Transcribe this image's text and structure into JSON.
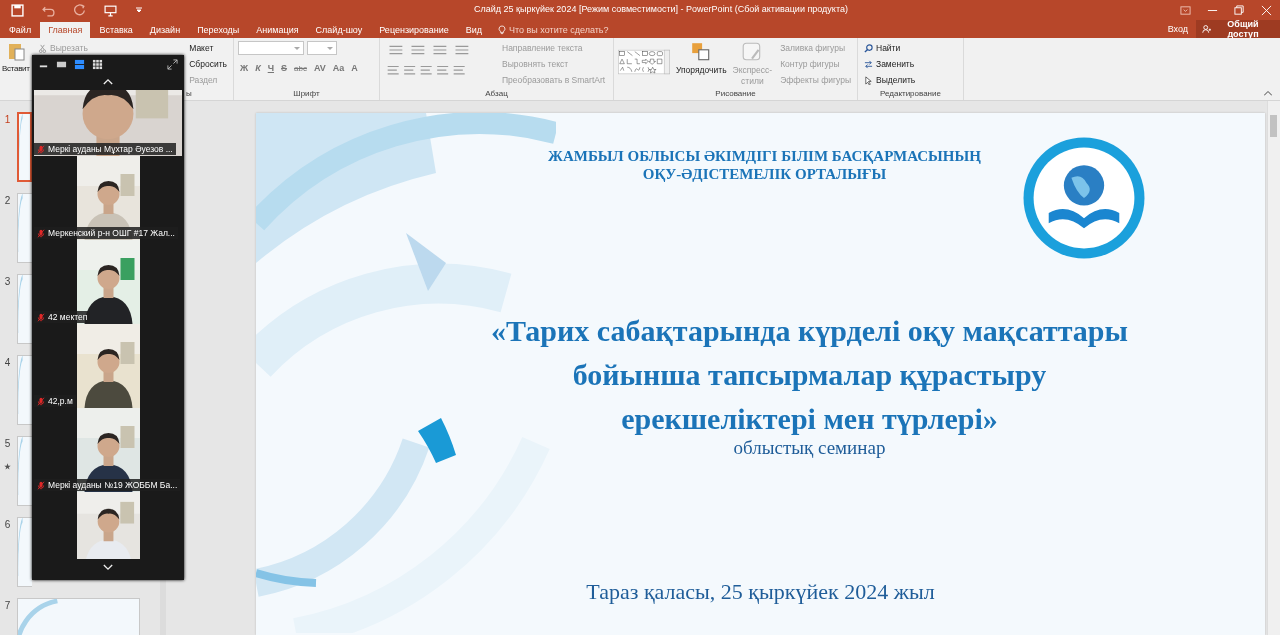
{
  "title_bar": {
    "title": "Слайд 25 қыркүйек  2024 [Режим совместимости] - PowerPoint (Сбой активации продукта)"
  },
  "tabs": [
    {
      "label": "Файл",
      "selected": false
    },
    {
      "label": "Главная",
      "selected": true
    },
    {
      "label": "Вставка",
      "selected": false
    },
    {
      "label": "Дизайн",
      "selected": false
    },
    {
      "label": "Переходы",
      "selected": false
    },
    {
      "label": "Анимация",
      "selected": false
    },
    {
      "label": "Слайд-шоу",
      "selected": false
    },
    {
      "label": "Рецензирование",
      "selected": false
    },
    {
      "label": "Вид",
      "selected": false
    }
  ],
  "tell_me": {
    "placeholder": "Что вы хотите сделать?"
  },
  "account": {
    "sign_in": "Вход",
    "share": "Общий доступ"
  },
  "ribbon": {
    "paste": "Вставит",
    "clipboard_commands": [
      {
        "label": "Вырезать",
        "disabled": true
      }
    ],
    "slide_commands": [
      {
        "label": "Макет",
        "disabled": false
      },
      {
        "label": "Сбросить",
        "disabled": false
      },
      {
        "label": "Раздел",
        "disabled": true
      }
    ],
    "slides_group_label": "ы",
    "font_group_label": "Шрифт",
    "font_buttons": [
      "Ж",
      "К",
      "Ч",
      "S",
      "abc",
      "AV",
      "Aa",
      "A"
    ],
    "paragraph_group_label": "Абзац",
    "paragraph_commands": [
      {
        "label": "Направление текста",
        "disabled": true
      },
      {
        "label": "Выровнять текст",
        "disabled": true
      },
      {
        "label": "Преобразовать в SmartArt",
        "disabled": true
      }
    ],
    "drawing_group_label": "Рисование",
    "arrange": "Упорядочить",
    "quick_styles": [
      "Экспресс-",
      "стили"
    ],
    "drawing_commands": [
      {
        "label": "Заливка фигуры",
        "disabled": true
      },
      {
        "label": "Контур фигуры",
        "disabled": true
      },
      {
        "label": "Эффекты фигуры",
        "disabled": true
      }
    ],
    "editing_group_label": "Редактирование",
    "editing_commands": [
      {
        "label": "Найти",
        "kind": "find"
      },
      {
        "label": "Заменить",
        "kind": "replace"
      },
      {
        "label": "Выделить",
        "kind": "select"
      }
    ]
  },
  "thumbnails": [
    {
      "number": "1",
      "selected": true,
      "starred": false
    },
    {
      "number": "2",
      "selected": false,
      "starred": false
    },
    {
      "number": "3",
      "selected": false,
      "starred": false
    },
    {
      "number": "4",
      "selected": false,
      "starred": false
    },
    {
      "number": "5",
      "selected": false,
      "starred": true
    },
    {
      "number": "6",
      "selected": false,
      "starred": false
    },
    {
      "number": "7",
      "selected": false,
      "starred": false
    }
  ],
  "zoom": {
    "tiles": [
      {
        "kind": "wide",
        "name": "Меркі ауданы Мұхтар Әуезов ..."
      },
      {
        "kind": "narrow",
        "name": "Меркенский р-н ОШГ #17  Жал..."
      },
      {
        "kind": "narrow",
        "name": "42 мектеп"
      },
      {
        "kind": "narrow",
        "name": "42,р.м"
      },
      {
        "kind": "narrow",
        "name": "Меркі ауданы №19 ЖОББМ Ба..."
      },
      {
        "kind": "narrow"
      }
    ]
  },
  "slide": {
    "header": [
      "ЖАМБЫЛ ОБЛЫСЫ ӘКІМДІГІ БІЛІМ БАСҚАРМАСЫНЫҢ",
      "ОҚУ-ӘДІСТЕМЕЛІК ОРТАЛЫҒЫ"
    ],
    "title": [
      "«Тарих сабақтарында күрделі оқу мақсаттары",
      "бойынша тапсырмалар құрастыру",
      "ерекшеліктері мен түрлері»"
    ],
    "subtitle": "облыстық семинар",
    "footer": "Тараз қаласы, 25 қыркүйек 2024 жыл"
  }
}
